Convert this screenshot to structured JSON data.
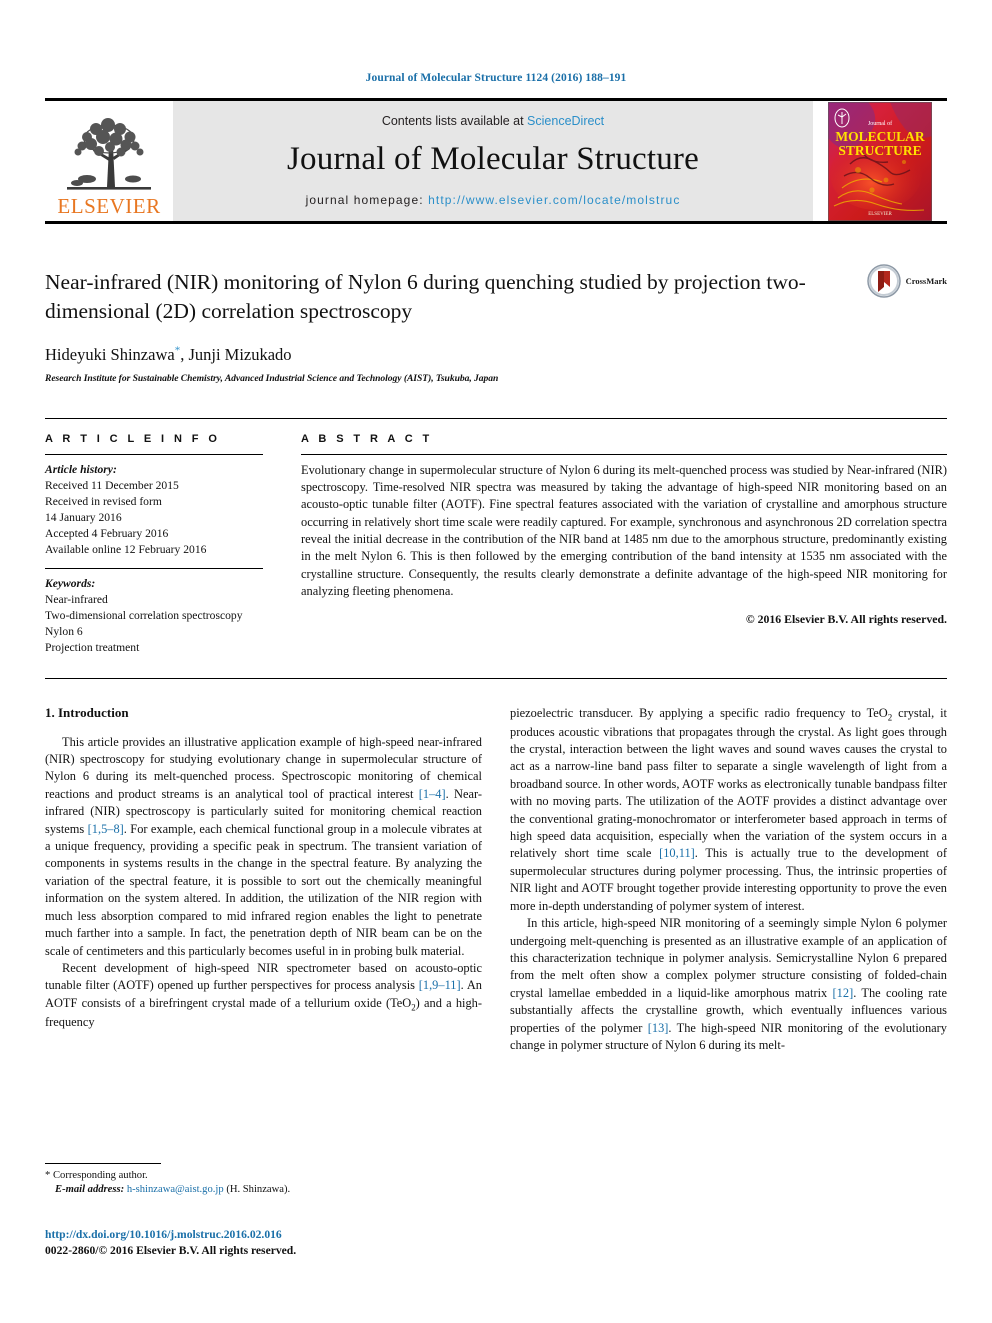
{
  "running_head": "Journal of Molecular Structure 1124 (2016) 188–191",
  "masthead": {
    "publisher_name": "ELSEVIER",
    "contents_prefix": "Contents lists available at ",
    "contents_link": "ScienceDirect",
    "journal_name": "Journal of Molecular Structure",
    "homepage_prefix": "journal homepage: ",
    "homepage_url": "http://www.elsevier.com/locate/molstruc",
    "cover_title_line1": "MOLECULAR",
    "cover_title_line2": "STRUCTURE",
    "cover_top_label": "Journal of",
    "cover_bottom_label": "ELSEVIER"
  },
  "article": {
    "title": "Near-infrared (NIR) monitoring of Nylon 6 during quenching studied by projection two-dimensional (2D) correlation spectroscopy",
    "authors": "Hideyuki Shinzawa, Junji Mizukado",
    "author_marker": "*",
    "affiliation": "Research Institute for Sustainable Chemistry, Advanced Industrial Science and Technology (AIST), Tsukuba, Japan",
    "crossmark_label": "CrossMark"
  },
  "article_info": {
    "heading": "A R T I C L E  I N F O",
    "history_label": "Article history:",
    "history": [
      "Received 11 December 2015",
      "Received in revised form",
      "14 January 2016",
      "Accepted 4 February 2016",
      "Available online 12 February 2016"
    ],
    "keywords_label": "Keywords:",
    "keywords": [
      "Near-infrared",
      "Two-dimensional correlation spectroscopy",
      "Nylon 6",
      "Projection treatment"
    ]
  },
  "abstract": {
    "heading": "A B S T R A C T",
    "text": "Evolutionary change in supermolecular structure of Nylon 6 during its melt-quenched process was studied by Near-infrared (NIR) spectroscopy. Time-resolved NIR spectra was measured by taking the advantage of high-speed NIR monitoring based on an acousto-optic tunable filter (AOTF). Fine spectral features associated with the variation of crystalline and amorphous structure occurring in relatively short time scale were readily captured. For example, synchronous and asynchronous 2D correlation spectra reveal the initial decrease in the contribution of the NIR band at 1485 nm due to the amorphous structure, predominantly existing in the melt Nylon 6. This is then followed by the emerging contribution of the band intensity at 1535 nm associated with the crystalline structure. Consequently, the results clearly demonstrate a definite advantage of the high-speed NIR monitoring for analyzing fleeting phenomena.",
    "copyright": "© 2016 Elsevier B.V. All rights reserved."
  },
  "body": {
    "section_title": "1. Introduction",
    "left_paragraphs": [
      {
        "segments": [
          {
            "t": "This article provides an illustrative application example of high-speed near-infrared (NIR) spectroscopy for studying evolutionary change in supermolecular structure of Nylon 6 during its melt-quenched process. Spectroscopic monitoring of chemical reactions and product streams is an analytical tool of practical interest "
          },
          {
            "t": "[1–4]",
            "cite": true
          },
          {
            "t": ". Near-infrared (NIR) spectroscopy is particularly suited for monitoring chemical reaction systems "
          },
          {
            "t": "[1,5–8]",
            "cite": true
          },
          {
            "t": ". For example, each chemical functional group in a molecule vibrates at a unique frequency, providing a specific peak in spectrum. The transient variation of components in systems results in the change in the spectral feature. By analyzing the variation of the spectral feature, it is possible to sort out the chemically meaningful information on the system altered. In addition, the utilization of the NIR region with much less absorption compared to mid infrared region enables the light to penetrate much farther into a sample. In fact, the penetration depth of NIR beam can be on the scale of centimeters and this particularly becomes useful in in probing bulk material."
          }
        ]
      },
      {
        "segments": [
          {
            "t": "Recent development of high-speed NIR spectrometer based on acousto-optic tunable filter (AOTF) opened up further perspectives for process analysis "
          },
          {
            "t": "[1,9–11]",
            "cite": true
          },
          {
            "t": ". An AOTF consists of a birefringent crystal made of a tellurium oxide (TeO"
          },
          {
            "t": "2",
            "sub": true
          },
          {
            "t": ") and a high-frequency"
          }
        ]
      }
    ],
    "right_paragraphs": [
      {
        "continuation": true,
        "segments": [
          {
            "t": "piezoelectric transducer. By applying a specific radio frequency to TeO"
          },
          {
            "t": "2",
            "sub": true
          },
          {
            "t": " crystal, it produces acoustic vibrations that propagates through the crystal. As light goes through the crystal, interaction between the light waves and sound waves causes the crystal to act as a narrow-line band pass filter to separate a single wavelength of light from a broadband source. In other words, AOTF works as electronically tunable bandpass filter with no moving parts. The utilization of the AOTF provides a distinct advantage over the conventional grating-monochromator or interferometer based approach in terms of high speed data acquisition, especially when the variation of the system occurs in a relatively short time scale "
          },
          {
            "t": "[10,11]",
            "cite": true
          },
          {
            "t": ". This is actually true to the development of supermolecular structures during polymer processing. Thus, the intrinsic properties of NIR light and AOTF brought together provide interesting opportunity to prove the even more in-depth understanding of polymer system of interest."
          }
        ]
      },
      {
        "segments": [
          {
            "t": "In this article, high-speed NIR monitoring of a seemingly simple Nylon 6 polymer undergoing melt-quenching is presented as an illustrative example of an application of this characterization technique in polymer analysis. Semicrystalline Nylon 6 prepared from the melt often show a complex polymer structure consisting of folded-chain crystal lamellae embedded in a liquid-like amorphous matrix "
          },
          {
            "t": "[12]",
            "cite": true
          },
          {
            "t": ". The cooling rate substantially affects the crystalline growth, which eventually influences various properties of the polymer "
          },
          {
            "t": "[13]",
            "cite": true
          },
          {
            "t": ". The high-speed NIR monitoring of the evolutionary change in polymer structure of Nylon 6 during its melt-"
          }
        ]
      }
    ]
  },
  "footer": {
    "corresponding_marker": "*",
    "corresponding_label": "Corresponding author.",
    "email_label": "E-mail address:",
    "email": "h-shinzawa@aist.go.jp",
    "email_suffix": "(H. Shinzawa).",
    "doi": "http://dx.doi.org/10.1016/j.molstruc.2016.02.016",
    "issn_line": "0022-2860/© 2016 Elsevier B.V. All rights reserved."
  },
  "colors": {
    "link_blue": "#1a6fa8",
    "sciencedirect_blue": "#2b8fc9",
    "elsevier_orange": "#e87722",
    "masthead_grey": "#e6e6e6",
    "cover_red": "#cc1b1b"
  }
}
